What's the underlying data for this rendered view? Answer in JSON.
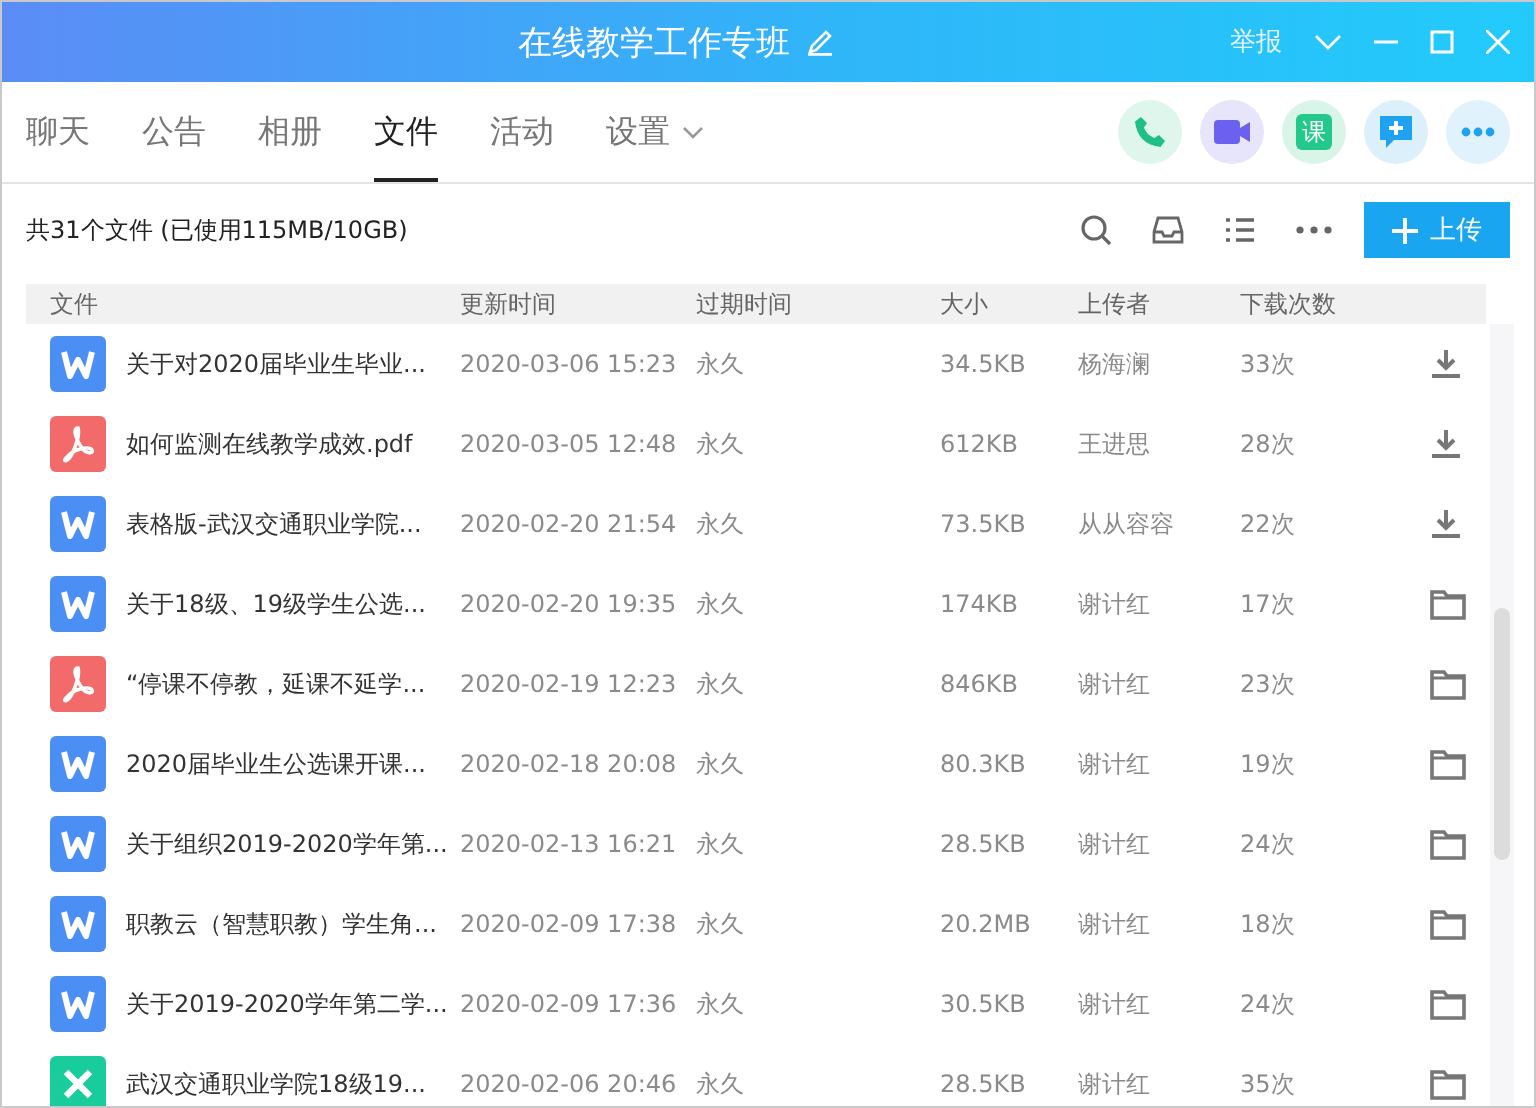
{
  "window": {
    "title": "在线教学工作专班",
    "report": "举报"
  },
  "tabs": [
    {
      "label": "聊天",
      "selected": false,
      "dropdown": false
    },
    {
      "label": "公告",
      "selected": false,
      "dropdown": false
    },
    {
      "label": "相册",
      "selected": false,
      "dropdown": false
    },
    {
      "label": "文件",
      "selected": true,
      "dropdown": false
    },
    {
      "label": "活动",
      "selected": false,
      "dropdown": false
    },
    {
      "label": "设置",
      "selected": false,
      "dropdown": true
    }
  ],
  "quick_actions": [
    {
      "kind": "phone"
    },
    {
      "kind": "video"
    },
    {
      "kind": "course",
      "text": "课"
    },
    {
      "kind": "chat"
    },
    {
      "kind": "more"
    }
  ],
  "summary": "共31个文件 (已使用115MB/10GB)",
  "upload_button": "上传",
  "table": {
    "columns": [
      "文件",
      "更新时间",
      "过期时间",
      "大小",
      "上传者",
      "下载次数"
    ],
    "rows": [
      {
        "kind": "word",
        "name": "关于对2020届毕业生毕业...",
        "updated": "2020-03-06 15:23",
        "expiry": "永久",
        "size": "34.5KB",
        "uploader": "杨海澜",
        "downloads": "33次",
        "action": {
          "kind": "download"
        }
      },
      {
        "kind": "pdf",
        "name": "如何监测在线教学成效.pdf",
        "updated": "2020-03-05 12:48",
        "expiry": "永久",
        "size": "612KB",
        "uploader": "王进思",
        "downloads": "28次",
        "action": {
          "kind": "download"
        }
      },
      {
        "kind": "word",
        "name": "表格版-武汉交通职业学院...",
        "updated": "2020-02-20 21:54",
        "expiry": "永久",
        "size": "73.5KB",
        "uploader": "从从容容",
        "downloads": "22次",
        "action": {
          "kind": "download"
        }
      },
      {
        "kind": "word",
        "name": "关于18级、19级学生公选...",
        "updated": "2020-02-20 19:35",
        "expiry": "永久",
        "size": "174KB",
        "uploader": "谢计红",
        "downloads": "17次",
        "action": {
          "kind": "folder"
        }
      },
      {
        "kind": "pdf",
        "name": "“停课不停教，延课不延学...",
        "updated": "2020-02-19 12:23",
        "expiry": "永久",
        "size": "846KB",
        "uploader": "谢计红",
        "downloads": "23次",
        "action": {
          "kind": "folder"
        }
      },
      {
        "kind": "word",
        "name": "2020届毕业生公选课开课...",
        "updated": "2020-02-18 20:08",
        "expiry": "永久",
        "size": "80.3KB",
        "uploader": "谢计红",
        "downloads": "19次",
        "action": {
          "kind": "folder"
        }
      },
      {
        "kind": "word",
        "name": "关于组织2019-2020学年第...",
        "updated": "2020-02-13 16:21",
        "expiry": "永久",
        "size": "28.5KB",
        "uploader": "谢计红",
        "downloads": "24次",
        "action": {
          "kind": "folder"
        }
      },
      {
        "kind": "word",
        "name": "职教云（智慧职教）学生角...",
        "updated": "2020-02-09 17:38",
        "expiry": "永久",
        "size": "20.2MB",
        "uploader": "谢计红",
        "downloads": "18次",
        "action": {
          "kind": "folder"
        }
      },
      {
        "kind": "word",
        "name": "关于2019-2020学年第二学...",
        "updated": "2020-02-09 17:36",
        "expiry": "永久",
        "size": "30.5KB",
        "uploader": "谢计红",
        "downloads": "24次",
        "action": {
          "kind": "folder"
        }
      },
      {
        "kind": "excel",
        "name": "武汉交通职业学院18级19...",
        "updated": "2020-02-06 20:46",
        "expiry": "永久",
        "size": "28.5KB",
        "uploader": "谢计红",
        "downloads": "35次",
        "action": {
          "kind": "folder"
        }
      }
    ]
  }
}
